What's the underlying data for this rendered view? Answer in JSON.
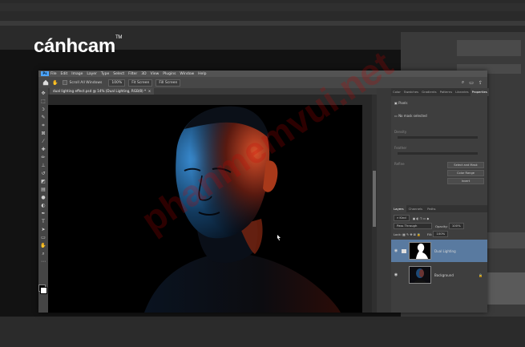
{
  "brand": {
    "name": "cánhcam",
    "mark": "TM"
  },
  "app": {
    "menu": [
      "File",
      "Edit",
      "Image",
      "Layer",
      "Type",
      "Select",
      "Filter",
      "3D",
      "View",
      "Plugins",
      "Window",
      "Help"
    ],
    "logo": "Ps",
    "options": {
      "scroll_all_windows": "Scroll All Windows",
      "zoom": "100%",
      "fit_screen": "Fit Screen",
      "fill_screen": "Fill Screen"
    },
    "doc_tab": "dual lighting effect.psd @ 14% (Dual Lighting, RGB/8) *"
  },
  "properties": {
    "tabs": [
      "Color",
      "Swatches",
      "Gradients",
      "Patterns",
      "Libraries",
      "Properties"
    ],
    "active_tab": "Properties",
    "pixel_label": "Pixels",
    "mask_label": "No mask selected",
    "density": "Density",
    "feather": "Feather",
    "refine": "Refine",
    "buttons": [
      "Select and Mask",
      "Color Range",
      "Invert"
    ]
  },
  "layers": {
    "tabs": [
      "Layers",
      "Channels",
      "Paths"
    ],
    "kind": "Kind",
    "blend_mode": "Pass Through",
    "opacity_label": "Opacity:",
    "opacity": "100%",
    "lock_label": "Lock:",
    "fill_label": "Fill:",
    "fill": "100%",
    "items": [
      {
        "name": "Dual Lighting",
        "selected": true
      },
      {
        "name": "Background",
        "selected": false
      }
    ]
  },
  "watermark": "phanmemvui.net"
}
